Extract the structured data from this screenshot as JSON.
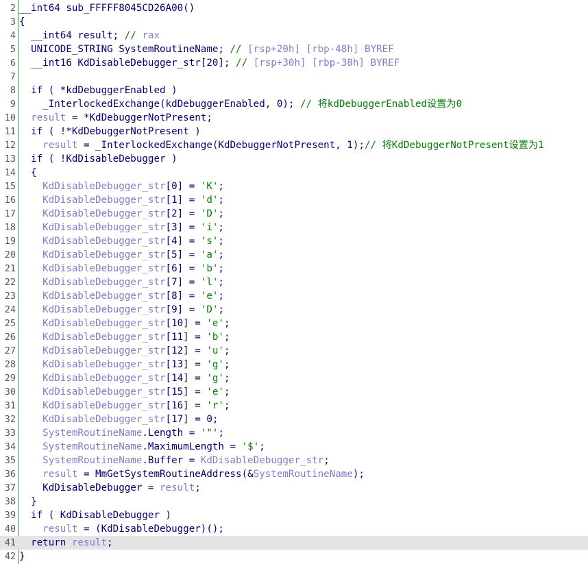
{
  "lines": [
    {
      "n": "2",
      "tokens": [
        {
          "t": "__int64 sub_FFFFF8045CD26A00()",
          "c": "id"
        }
      ]
    },
    {
      "n": "3",
      "tokens": [
        {
          "t": "{",
          "c": "id"
        }
      ]
    },
    {
      "n": "4",
      "tokens": [
        {
          "t": "  __int64 result; ",
          "c": "id"
        },
        {
          "t": "// ",
          "c": "cm"
        },
        {
          "t": "rax",
          "c": "cmv"
        }
      ]
    },
    {
      "n": "5",
      "tokens": [
        {
          "t": "  UNICODE_STRING SystemRoutineName; ",
          "c": "id"
        },
        {
          "t": "// ",
          "c": "cm"
        },
        {
          "t": "[rsp+20h] [rbp-48h] BYREF",
          "c": "cmv"
        }
      ]
    },
    {
      "n": "6",
      "tokens": [
        {
          "t": "  __int16 KdDisableDebugger_str[20]; ",
          "c": "id"
        },
        {
          "t": "// ",
          "c": "cm"
        },
        {
          "t": "[rsp+30h] [rbp-38h] BYREF",
          "c": "cmv"
        }
      ]
    },
    {
      "n": "7",
      "tokens": []
    },
    {
      "n": "8",
      "tokens": [
        {
          "t": "  if ( *kdDebuggerEnabled )",
          "c": "id"
        }
      ]
    },
    {
      "n": "9",
      "tokens": [
        {
          "t": "    _InterlockedExchange(kdDebuggerEnabled, 0); ",
          "c": "id"
        },
        {
          "t": "// 将kdDebuggerEnabled设置为0",
          "c": "cm"
        }
      ]
    },
    {
      "n": "10",
      "tokens": [
        {
          "t": "  ",
          "c": "id"
        },
        {
          "t": "result",
          "c": "var"
        },
        {
          "t": " = *KdDebuggerNotPresent;",
          "c": "id"
        }
      ]
    },
    {
      "n": "11",
      "tokens": [
        {
          "t": "  if ( !*KdDebuggerNotPresent )",
          "c": "id"
        }
      ]
    },
    {
      "n": "12",
      "tokens": [
        {
          "t": "    ",
          "c": "id"
        },
        {
          "t": "result",
          "c": "var"
        },
        {
          "t": " = _InterlockedExchange(KdDebuggerNotPresent, 1);",
          "c": "id"
        },
        {
          "t": "// 将KdDebuggerNotPresent设置为1",
          "c": "cm"
        }
      ]
    },
    {
      "n": "13",
      "tokens": [
        {
          "t": "  if ( !KdDisableDebugger )",
          "c": "id"
        }
      ]
    },
    {
      "n": "14",
      "tokens": [
        {
          "t": "  {",
          "c": "id"
        }
      ]
    },
    {
      "n": "15",
      "tokens": [
        {
          "t": "    ",
          "c": "id"
        },
        {
          "t": "KdDisableDebugger_str",
          "c": "var"
        },
        {
          "t": "[0] = ",
          "c": "id"
        },
        {
          "t": "'K'",
          "c": "str"
        },
        {
          "t": ";",
          "c": "id"
        }
      ]
    },
    {
      "n": "16",
      "tokens": [
        {
          "t": "    ",
          "c": "id"
        },
        {
          "t": "KdDisableDebugger_str",
          "c": "var"
        },
        {
          "t": "[1] = ",
          "c": "id"
        },
        {
          "t": "'d'",
          "c": "str"
        },
        {
          "t": ";",
          "c": "id"
        }
      ]
    },
    {
      "n": "17",
      "tokens": [
        {
          "t": "    ",
          "c": "id"
        },
        {
          "t": "KdDisableDebugger_str",
          "c": "var"
        },
        {
          "t": "[2] = ",
          "c": "id"
        },
        {
          "t": "'D'",
          "c": "str"
        },
        {
          "t": ";",
          "c": "id"
        }
      ]
    },
    {
      "n": "18",
      "tokens": [
        {
          "t": "    ",
          "c": "id"
        },
        {
          "t": "KdDisableDebugger_str",
          "c": "var"
        },
        {
          "t": "[3] = ",
          "c": "id"
        },
        {
          "t": "'i'",
          "c": "str"
        },
        {
          "t": ";",
          "c": "id"
        }
      ]
    },
    {
      "n": "19",
      "tokens": [
        {
          "t": "    ",
          "c": "id"
        },
        {
          "t": "KdDisableDebugger_str",
          "c": "var"
        },
        {
          "t": "[4] = ",
          "c": "id"
        },
        {
          "t": "'s'",
          "c": "str"
        },
        {
          "t": ";",
          "c": "id"
        }
      ]
    },
    {
      "n": "20",
      "tokens": [
        {
          "t": "    ",
          "c": "id"
        },
        {
          "t": "KdDisableDebugger_str",
          "c": "var"
        },
        {
          "t": "[5] = ",
          "c": "id"
        },
        {
          "t": "'a'",
          "c": "str"
        },
        {
          "t": ";",
          "c": "id"
        }
      ]
    },
    {
      "n": "21",
      "tokens": [
        {
          "t": "    ",
          "c": "id"
        },
        {
          "t": "KdDisableDebugger_str",
          "c": "var"
        },
        {
          "t": "[6] = ",
          "c": "id"
        },
        {
          "t": "'b'",
          "c": "str"
        },
        {
          "t": ";",
          "c": "id"
        }
      ]
    },
    {
      "n": "22",
      "tokens": [
        {
          "t": "    ",
          "c": "id"
        },
        {
          "t": "KdDisableDebugger_str",
          "c": "var"
        },
        {
          "t": "[7] = ",
          "c": "id"
        },
        {
          "t": "'l'",
          "c": "str"
        },
        {
          "t": ";",
          "c": "id"
        }
      ]
    },
    {
      "n": "23",
      "tokens": [
        {
          "t": "    ",
          "c": "id"
        },
        {
          "t": "KdDisableDebugger_str",
          "c": "var"
        },
        {
          "t": "[8] = ",
          "c": "id"
        },
        {
          "t": "'e'",
          "c": "str"
        },
        {
          "t": ";",
          "c": "id"
        }
      ]
    },
    {
      "n": "24",
      "tokens": [
        {
          "t": "    ",
          "c": "id"
        },
        {
          "t": "KdDisableDebugger_str",
          "c": "var"
        },
        {
          "t": "[9] = ",
          "c": "id"
        },
        {
          "t": "'D'",
          "c": "str"
        },
        {
          "t": ";",
          "c": "id"
        }
      ]
    },
    {
      "n": "25",
      "tokens": [
        {
          "t": "    ",
          "c": "id"
        },
        {
          "t": "KdDisableDebugger_str",
          "c": "var"
        },
        {
          "t": "[10] = ",
          "c": "id"
        },
        {
          "t": "'e'",
          "c": "str"
        },
        {
          "t": ";",
          "c": "id"
        }
      ]
    },
    {
      "n": "26",
      "tokens": [
        {
          "t": "    ",
          "c": "id"
        },
        {
          "t": "KdDisableDebugger_str",
          "c": "var"
        },
        {
          "t": "[11] = ",
          "c": "id"
        },
        {
          "t": "'b'",
          "c": "str"
        },
        {
          "t": ";",
          "c": "id"
        }
      ]
    },
    {
      "n": "27",
      "tokens": [
        {
          "t": "    ",
          "c": "id"
        },
        {
          "t": "KdDisableDebugger_str",
          "c": "var"
        },
        {
          "t": "[12] = ",
          "c": "id"
        },
        {
          "t": "'u'",
          "c": "str"
        },
        {
          "t": ";",
          "c": "id"
        }
      ]
    },
    {
      "n": "28",
      "tokens": [
        {
          "t": "    ",
          "c": "id"
        },
        {
          "t": "KdDisableDebugger_str",
          "c": "var"
        },
        {
          "t": "[13] = ",
          "c": "id"
        },
        {
          "t": "'g'",
          "c": "str"
        },
        {
          "t": ";",
          "c": "id"
        }
      ]
    },
    {
      "n": "29",
      "tokens": [
        {
          "t": "    ",
          "c": "id"
        },
        {
          "t": "KdDisableDebugger_str",
          "c": "var"
        },
        {
          "t": "[14] = ",
          "c": "id"
        },
        {
          "t": "'g'",
          "c": "str"
        },
        {
          "t": ";",
          "c": "id"
        }
      ]
    },
    {
      "n": "30",
      "tokens": [
        {
          "t": "    ",
          "c": "id"
        },
        {
          "t": "KdDisableDebugger_str",
          "c": "var"
        },
        {
          "t": "[15] = ",
          "c": "id"
        },
        {
          "t": "'e'",
          "c": "str"
        },
        {
          "t": ";",
          "c": "id"
        }
      ]
    },
    {
      "n": "31",
      "tokens": [
        {
          "t": "    ",
          "c": "id"
        },
        {
          "t": "KdDisableDebugger_str",
          "c": "var"
        },
        {
          "t": "[16] = ",
          "c": "id"
        },
        {
          "t": "'r'",
          "c": "str"
        },
        {
          "t": ";",
          "c": "id"
        }
      ]
    },
    {
      "n": "32",
      "tokens": [
        {
          "t": "    ",
          "c": "id"
        },
        {
          "t": "KdDisableDebugger_str",
          "c": "var"
        },
        {
          "t": "[17] = 0;",
          "c": "id"
        }
      ]
    },
    {
      "n": "33",
      "tokens": [
        {
          "t": "    ",
          "c": "id"
        },
        {
          "t": "SystemRoutineName",
          "c": "var"
        },
        {
          "t": ".Length = ",
          "c": "id"
        },
        {
          "t": "'\"'",
          "c": "str"
        },
        {
          "t": ";",
          "c": "id"
        }
      ]
    },
    {
      "n": "34",
      "tokens": [
        {
          "t": "    ",
          "c": "id"
        },
        {
          "t": "SystemRoutineName",
          "c": "var"
        },
        {
          "t": ".MaximumLength = ",
          "c": "id"
        },
        {
          "t": "'$'",
          "c": "str"
        },
        {
          "t": ";",
          "c": "id"
        }
      ]
    },
    {
      "n": "35",
      "tokens": [
        {
          "t": "    ",
          "c": "id"
        },
        {
          "t": "SystemRoutineName",
          "c": "var"
        },
        {
          "t": ".Buffer = ",
          "c": "id"
        },
        {
          "t": "KdDisableDebugger_str",
          "c": "var"
        },
        {
          "t": ";",
          "c": "id"
        }
      ]
    },
    {
      "n": "36",
      "tokens": [
        {
          "t": "    ",
          "c": "id"
        },
        {
          "t": "result",
          "c": "var"
        },
        {
          "t": " = MmGetSystemRoutineAddress(&",
          "c": "id"
        },
        {
          "t": "SystemRoutineName",
          "c": "var"
        },
        {
          "t": ");",
          "c": "id"
        }
      ]
    },
    {
      "n": "37",
      "tokens": [
        {
          "t": "    KdDisableDebugger = ",
          "c": "id"
        },
        {
          "t": "result",
          "c": "var"
        },
        {
          "t": ";",
          "c": "id"
        }
      ]
    },
    {
      "n": "38",
      "tokens": [
        {
          "t": "  }",
          "c": "id"
        }
      ]
    },
    {
      "n": "39",
      "tokens": [
        {
          "t": "  if ( KdDisableDebugger )",
          "c": "id"
        }
      ]
    },
    {
      "n": "40",
      "tokens": [
        {
          "t": "    ",
          "c": "id"
        },
        {
          "t": "result",
          "c": "var"
        },
        {
          "t": " = (KdDisableDebugger)();",
          "c": "id"
        }
      ]
    },
    {
      "n": "41",
      "current": true,
      "tokens": [
        {
          "t": "  return ",
          "c": "id"
        },
        {
          "t": "result",
          "c": "var"
        },
        {
          "t": ";",
          "c": "id"
        }
      ]
    },
    {
      "n": "42",
      "tokens": [
        {
          "t": "}",
          "c": "id"
        }
      ]
    }
  ]
}
